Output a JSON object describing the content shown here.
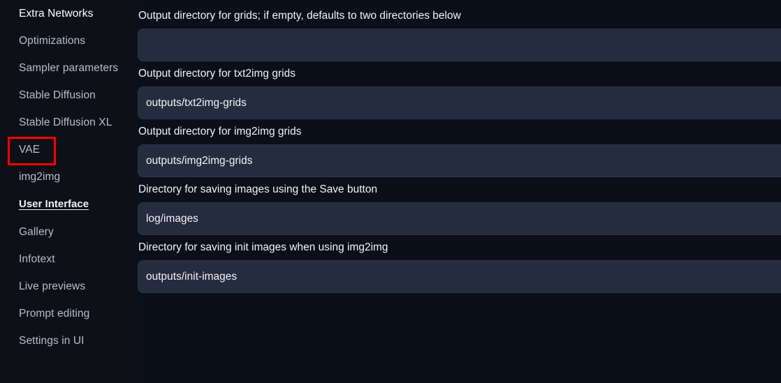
{
  "sidebar": {
    "items": [
      {
        "label": "Extra Networks",
        "type": "item",
        "highlighted": false
      },
      {
        "label": "Optimizations",
        "type": "item",
        "highlighted": false
      },
      {
        "label": "Sampler parameters",
        "type": "item",
        "highlighted": false
      },
      {
        "label": "Stable Diffusion",
        "type": "item",
        "highlighted": false
      },
      {
        "label": "Stable Diffusion XL",
        "type": "item",
        "highlighted": false
      },
      {
        "label": "VAE",
        "type": "item",
        "highlighted": true
      },
      {
        "label": "img2img",
        "type": "item",
        "highlighted": false
      },
      {
        "label": "User Interface",
        "type": "group",
        "highlighted": false
      },
      {
        "label": "Gallery",
        "type": "item",
        "highlighted": false
      },
      {
        "label": "Infotext",
        "type": "item",
        "highlighted": false
      },
      {
        "label": "Live previews",
        "type": "item",
        "highlighted": false
      },
      {
        "label": "Prompt editing",
        "type": "item",
        "highlighted": false
      },
      {
        "label": "Settings in UI",
        "type": "item",
        "highlighted": false
      }
    ],
    "selected": "VAE"
  },
  "highlight": {
    "target": "VAE",
    "color": "#fe0000"
  },
  "main": {
    "fields": [
      {
        "label": "Output directory for grids; if empty, defaults to two directories below",
        "value": "",
        "placeholder": ""
      },
      {
        "label": "Output directory for txt2img grids",
        "value": "outputs/txt2img-grids",
        "placeholder": ""
      },
      {
        "label": "Output directory for img2img grids",
        "value": "outputs/img2img-grids",
        "placeholder": ""
      },
      {
        "label": "Directory for saving images using the Save button",
        "value": "log/images",
        "placeholder": ""
      },
      {
        "label": "Directory for saving init images when using img2img",
        "value": "outputs/init-images",
        "placeholder": ""
      }
    ]
  },
  "theme": {
    "page_background": "#0b0f19",
    "sidebar_background": "#0d1117",
    "input_background": "#242c3d",
    "input_border": "#2d364a",
    "label_color": "#f2f5f9",
    "nav_color": "#b5bfcc",
    "highlight_color": "#fe0000"
  }
}
